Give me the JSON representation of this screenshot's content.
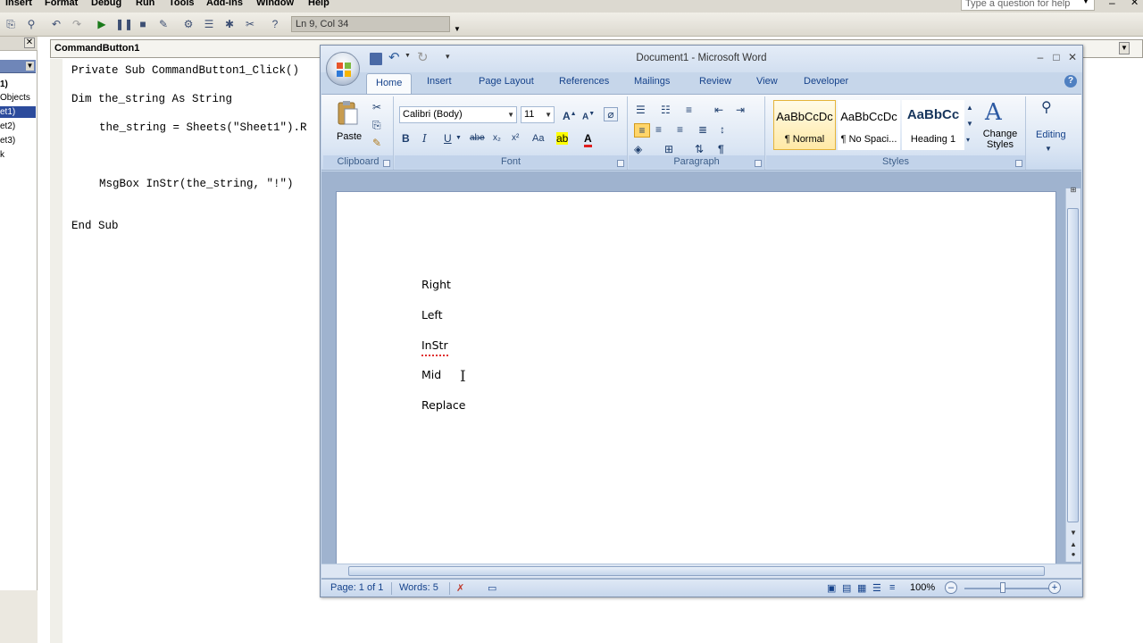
{
  "vbe": {
    "menus": [
      "Insert",
      "Format",
      "Debug",
      "Run",
      "Tools",
      "Add-Ins",
      "Window",
      "Help"
    ],
    "lncol": "Ln 9, Col 34",
    "help_placeholder": "Type a question for help",
    "project_items": [
      "1)",
      "Objects",
      "et1)",
      "et2)",
      "et3)",
      "k"
    ],
    "object_combo": "CommandButton1",
    "code": {
      "line1": "Private Sub CommandButton1_Click()",
      "line2": "Dim the_string As String",
      "line3": "the_string = Sheets(\"Sheet1\").R",
      "line4": "MsgBox InStr(the_string, \"!\")",
      "line5": "End Sub"
    }
  },
  "word": {
    "title": "Document1 - Microsoft Word",
    "tabs": [
      "Home",
      "Insert",
      "Page Layout",
      "References",
      "Mailings",
      "Review",
      "View",
      "Developer"
    ],
    "groups": {
      "clipboard": "Clipboard",
      "font": "Font",
      "paragraph": "Paragraph",
      "styles": "Styles"
    },
    "paste_label": "Paste",
    "font_name": "Calibri (Body)",
    "font_size": "11",
    "styles": [
      {
        "sample": "AaBbCcDc",
        "name": "¶ Normal"
      },
      {
        "sample": "AaBbCcDc",
        "name": "¶ No Spaci..."
      },
      {
        "sample": "AaBbCc",
        "name": "Heading 1"
      }
    ],
    "change_styles_label": "Change Styles",
    "editing_label": "Editing",
    "document_lines": [
      "Right",
      "Left",
      "InStr",
      "Mid",
      "Replace"
    ],
    "status": {
      "page": "Page: 1 of 1",
      "words": "Words: 5",
      "zoom": "100%"
    }
  }
}
